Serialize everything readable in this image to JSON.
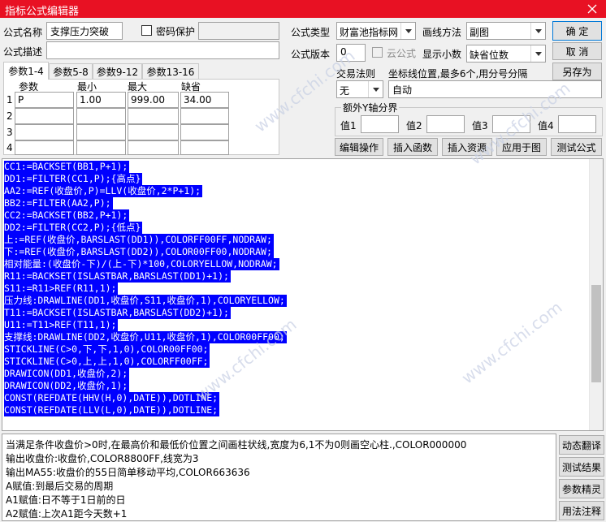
{
  "window": {
    "title": "指标公式编辑器"
  },
  "form": {
    "name_label": "公式名称",
    "name_value": "支撑压力突破",
    "password_label": "密码保护",
    "desc_label": "公式描述",
    "desc_value": "",
    "type_label": "公式类型",
    "type_value": "财富池指标网",
    "draw_label": "画线方法",
    "draw_value": "副图",
    "version_label": "公式版本",
    "version_value": "0",
    "cloud_label": "云公式",
    "decimals_label": "显示小数",
    "decimals_value": "缺省位数"
  },
  "buttons": {
    "ok": "确  定",
    "cancel": "取  消",
    "save_as": "另存为",
    "edit_op": "编辑操作",
    "insert_func": "插入函数",
    "insert_res": "插入资源",
    "apply_chart": "应用于图",
    "test": "测试公式"
  },
  "tabs": [
    "参数1-4",
    "参数5-8",
    "参数9-12",
    "参数13-16"
  ],
  "params": {
    "headers": [
      "参数",
      "最小",
      "最大",
      "缺省"
    ],
    "rows": [
      {
        "no": "1",
        "name": "P",
        "min": "1.00",
        "max": "999.00",
        "def": "34.00"
      },
      {
        "no": "2",
        "name": "",
        "min": "",
        "max": "",
        "def": ""
      },
      {
        "no": "3",
        "name": "",
        "min": "",
        "max": "",
        "def": ""
      },
      {
        "no": "4",
        "name": "",
        "min": "",
        "max": "",
        "def": ""
      }
    ]
  },
  "trade": {
    "rule_label": "交易法则",
    "rule_value": "无",
    "axis_label": "坐标线位置,最多6个,用分号分隔",
    "axis_value": "自动",
    "yaxis_title": "额外Y轴分界",
    "values": [
      "值1",
      "值2",
      "值3",
      "值4"
    ]
  },
  "code": [
    "CC1:=BACKSET(BB1,P+1);",
    "DD1:=FILTER(CC1,P);{高点}",
    "AA2:=REF(收盘价,P)=LLV(收盘价,2*P+1);",
    "BB2:=FILTER(AA2,P);",
    "CC2:=BACKSET(BB2,P+1);",
    "DD2:=FILTER(CC2,P);{低点}",
    "上:=REF(收盘价,BARSLAST(DD1)),COLORFF00FF,NODRAW;",
    "下:=REF(收盘价,BARSLAST(DD2)),COLOR00FF00,NODRAW;",
    "相对能量:(收盘价-下)/(上-下)*100,COLORYELLOW,NODRAW;",
    "R11:=BACKSET(ISLASTBAR,BARSLAST(DD1)+1);",
    "S11:=R11>REF(R11,1);",
    "压力线:DRAWLINE(DD1,收盘价,S11,收盘价,1),COLORYELLOW;",
    "T11:=BACKSET(ISLASTBAR,BARSLAST(DD2)+1);",
    "U11:=T11>REF(T11,1);",
    "支撑线:DRAWLINE(DD2,收盘价,U11,收盘价,1),COLOR00FF00;",
    "STICKLINE(C>0,下,下,1,0),COLOR00FF00;",
    "STICKLINE(C>0,上,上,1,0),COLORFF00FF;",
    "DRAWICON(DD1,收盘价,2);",
    "DRAWICON(DD2,收盘价,1);",
    "CONST(REFDATE(HHV(H,0),DATE)),DOTLINE;",
    "CONST(REFDATE(LLV(L,0),DATE)),DOTLINE;"
  ],
  "output": [
    "当满足条件收盘价>0时,在最高价和最低价位置之间画柱状线,宽度为6,1不为0则画空心柱.,COLOR000000",
    "输出收盘价:收盘价,COLOR8800FF,线宽为3",
    "输出MA55:收盘价的55日简单移动平均,COLOR663636",
    "A赋值:到最后交易的周期",
    "A1赋值:日不等于1日前的日",
    "A2赋值:上次A1距今天数+1"
  ],
  "side_buttons": [
    "动态翻译",
    "测试结果",
    "参数精灵",
    "用法注释"
  ],
  "watermark": "www.cfchi.com"
}
